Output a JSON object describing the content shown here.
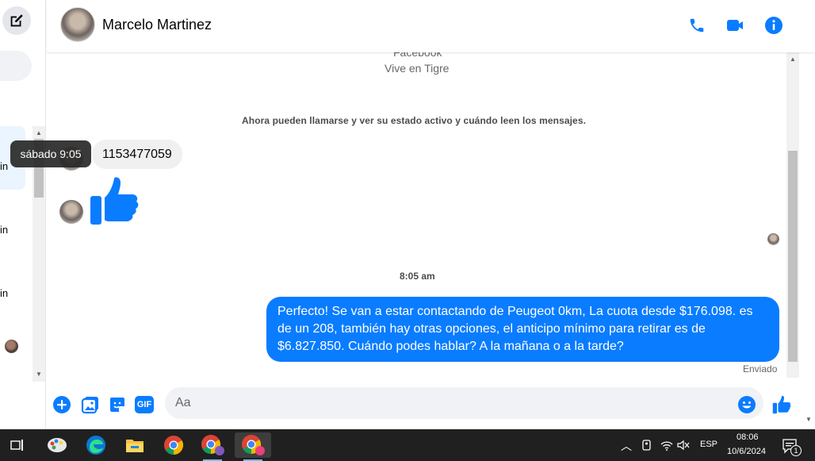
{
  "window": {
    "contact_name": "Marcelo Martinez"
  },
  "sidebar": {
    "fragments": [
      "in",
      "in",
      "in"
    ]
  },
  "header": {
    "icons": [
      "phone-icon",
      "video-camera-icon",
      "info-icon"
    ],
    "accent_color": "#0a7cff"
  },
  "conversation": {
    "profile_platform_cut": "Facebook",
    "profile_location": "Vive en Tigre",
    "notice": "Ahora pueden llamarse y ver su estado activo y cuándo leen los mensajes.",
    "received_message": "1153477059",
    "tooltip": "sábado 9:05",
    "time_separator": "8:05 am",
    "sent_message": "Perfecto!  Se van a estar contactando de Peugeot 0km, La cuota desde $176.098. es de un 208, también hay otras opciones, el anticipo mínimo para retirar es de $6.827.850. Cuándo podes hablar? A la mañana o a la tarde?",
    "sent_status": "Enviado"
  },
  "composer": {
    "placeholder": "Aa",
    "icons": [
      "plus-circle-icon",
      "image-icon",
      "sticker-icon",
      "gif-icon",
      "emoji-icon",
      "thumbs-up-icon"
    ],
    "gif_label": "GIF"
  },
  "taskbar": {
    "apps": [
      "task-view-icon",
      "paint-app-icon",
      "edge-icon",
      "file-explorer-icon",
      "chrome-icon",
      "chrome-profile-icon",
      "chrome-profile-active-icon"
    ],
    "language": "ESP",
    "time": "08:06",
    "date": "10/6/2024",
    "notification_count": "1"
  }
}
